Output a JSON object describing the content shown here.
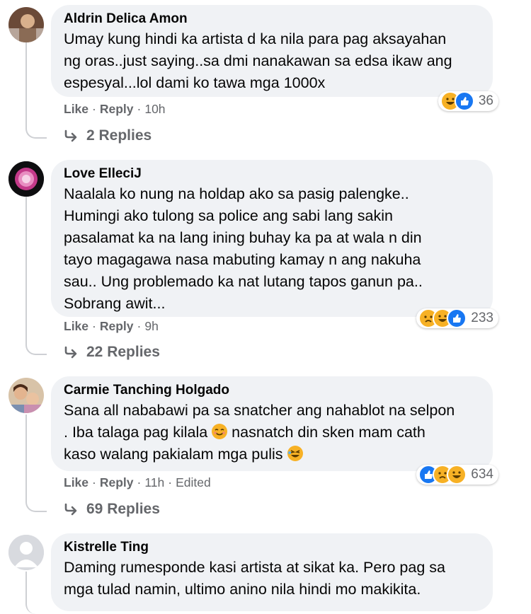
{
  "comments": [
    {
      "author": "Aldrin Delica Amon",
      "lines": [
        "Umay kung hindi ka artista d ka nila para pag aksayahan",
        "ng oras..just saying..sa dmi nanakawan sa edsa ikaw ang",
        "espesyal...lol dami ko tawa mga 1000x"
      ],
      "reaction_count": "36",
      "reactions": [
        "haha",
        "like"
      ],
      "like": "Like",
      "reply": "Reply",
      "time": "10h",
      "replies": "2 Replies"
    },
    {
      "author": "Love ElleciJ",
      "lines": [
        "Naalala ko nung na holdap ako sa pasig palengke..",
        "Humingi ako tulong sa police ang sabi lang sakin",
        "pasalamat ka na lang ining buhay ka pa at wala n din",
        "tayo magagawa nasa mabuting kamay n ang nakuha",
        "sau.. Ung problemado ka nat lutang tapos ganun pa..",
        "Sobrang awit..."
      ],
      "reaction_count": "233",
      "reactions": [
        "sad",
        "haha",
        "like"
      ],
      "like": "Like",
      "reply": "Reply",
      "time": "9h",
      "replies": "22 Replies"
    },
    {
      "author": "Carmie Tanching Holgado",
      "line1": "Sana all nababawi pa sa snatcher ang nahablot na selpon",
      "line2a": ". Iba talaga pag kilala",
      "line2b": "nasnatch din sken mam cath",
      "line3": "kaso walang pakialam mga pulis",
      "reaction_count": "634",
      "reactions": [
        "like",
        "sad",
        "haha"
      ],
      "like": "Like",
      "reply": "Reply",
      "time": "11h",
      "edited": "Edited",
      "replies": "69 Replies"
    },
    {
      "author": "Kistrelle Ting",
      "lines": [
        "Daming rumesponde kasi artista at sikat ka. Pero pag sa",
        "mga tulad namin, ultimo anino nila hindi mo makikita."
      ]
    }
  ],
  "separator": "·"
}
